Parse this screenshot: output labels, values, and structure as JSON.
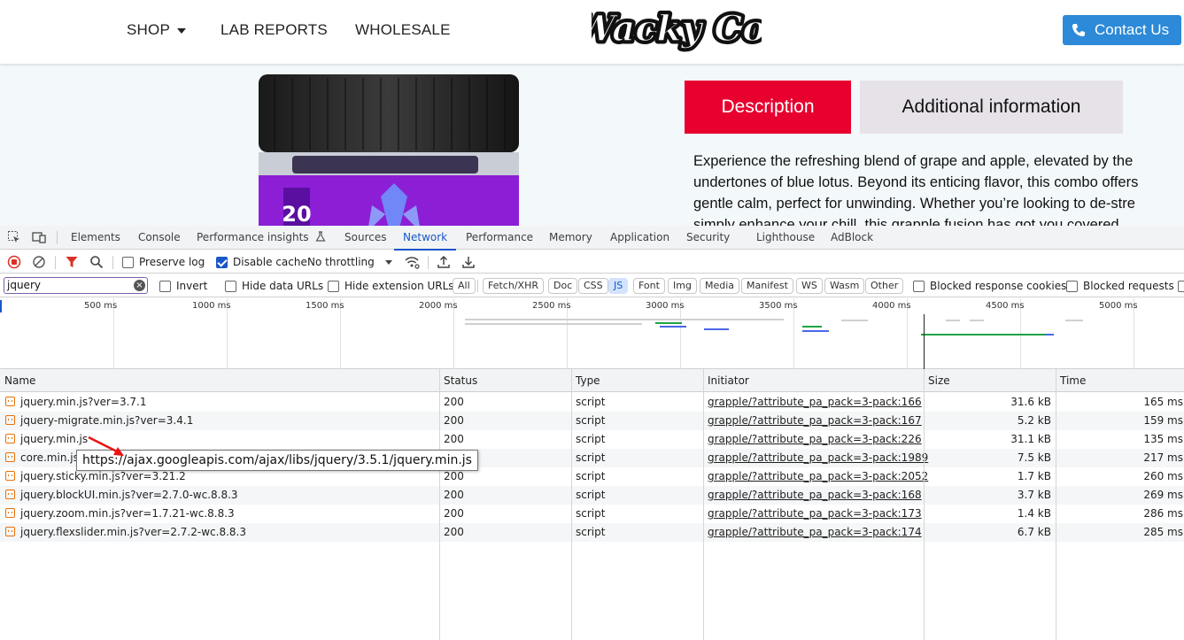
{
  "site": {
    "nav": {
      "shop": "SHOP",
      "lab_reports": "LAB REPORTS",
      "wholesale": "WHOLESALE"
    },
    "logo_text": "Wacky Co.",
    "contact_label": "Contact Us",
    "jar_label": "20",
    "tabs": {
      "description": "Description",
      "additional": "Additional information"
    },
    "description_lines": [
      "Experience the refreshing blend of grape and apple, elevated by the",
      "undertones of blue lotus. Beyond its enticing flavor, this combo offers",
      "gentle calm, perfect for unwinding. Whether you’re looking to de-stre",
      "simply enhance your chill, this grapple fusion has got you covered."
    ],
    "colors": {
      "accent_red": "#e8002f",
      "contact_blue": "#2c8ad8"
    }
  },
  "devtools": {
    "tabs": [
      "Elements",
      "Console",
      "Performance insights",
      "Sources",
      "Network",
      "Performance",
      "Memory",
      "Application",
      "Security",
      "Lighthouse",
      "AdBlock"
    ],
    "active_tab": "Network",
    "toolbar": {
      "preserve_log": "Preserve log",
      "disable_cache": "Disable cache",
      "throttling": "No throttling"
    },
    "filter": {
      "value": "jquery",
      "invert": "Invert",
      "hide_data_urls": "Hide data URLs",
      "hide_extension_urls": "Hide extension URLs",
      "chips": [
        "All",
        "Fetch/XHR",
        "Doc",
        "CSS",
        "JS",
        "Font",
        "Img",
        "Media",
        "Manifest",
        "WS",
        "Wasm",
        "Other"
      ],
      "active_chip": "JS",
      "blocked_cookies": "Blocked response cookies",
      "blocked_requests": "Blocked requests"
    },
    "timeline_labels": [
      "500 ms",
      "1000 ms",
      "1500 ms",
      "2000 ms",
      "2500 ms",
      "3000 ms",
      "3500 ms",
      "4000 ms",
      "4500 ms",
      "5000 ms"
    ],
    "columns": [
      "Name",
      "Status",
      "Type",
      "Initiator",
      "Size",
      "Time"
    ],
    "rows": [
      {
        "name": "jquery.min.js?ver=3.7.1",
        "status": "200",
        "type": "script",
        "initiator": "grapple/?attribute_pa_pack=3-pack:166",
        "size": "31.6 kB",
        "time": "165 ms"
      },
      {
        "name": "jquery-migrate.min.js?ver=3.4.1",
        "status": "200",
        "type": "script",
        "initiator": "grapple/?attribute_pa_pack=3-pack:167",
        "size": "5.2 kB",
        "time": "159 ms"
      },
      {
        "name": "jquery.min.js",
        "status": "200",
        "type": "script",
        "initiator": "grapple/?attribute_pa_pack=3-pack:226",
        "size": "31.1 kB",
        "time": "135 ms"
      },
      {
        "name": "core.min.js?",
        "status": "200",
        "type": "script",
        "initiator": "grapple/?attribute_pa_pack=3-pack:1989",
        "size": "7.5 kB",
        "time": "217 ms"
      },
      {
        "name": "jquery.sticky.min.js?ver=3.21.2",
        "status": "200",
        "type": "script",
        "initiator": "grapple/?attribute_pa_pack=3-pack:2052",
        "size": "1.7 kB",
        "time": "260 ms"
      },
      {
        "name": "jquery.blockUI.min.js?ver=2.7.0-wc.8.8.3",
        "status": "200",
        "type": "script",
        "initiator": "grapple/?attribute_pa_pack=3-pack:168",
        "size": "3.7 kB",
        "time": "269 ms"
      },
      {
        "name": "jquery.zoom.min.js?ver=1.7.21-wc.8.8.3",
        "status": "200",
        "type": "script",
        "initiator": "grapple/?attribute_pa_pack=3-pack:173",
        "size": "1.4 kB",
        "time": "286 ms"
      },
      {
        "name": "jquery.flexslider.min.js?ver=2.7.2-wc.8.8.3",
        "status": "200",
        "type": "script",
        "initiator": "grapple/?attribute_pa_pack=3-pack:174",
        "size": "6.7 kB",
        "time": "285 ms"
      }
    ],
    "tooltip": "https://ajax.googleapis.com/ajax/libs/jquery/3.5.1/jquery.min.js"
  }
}
